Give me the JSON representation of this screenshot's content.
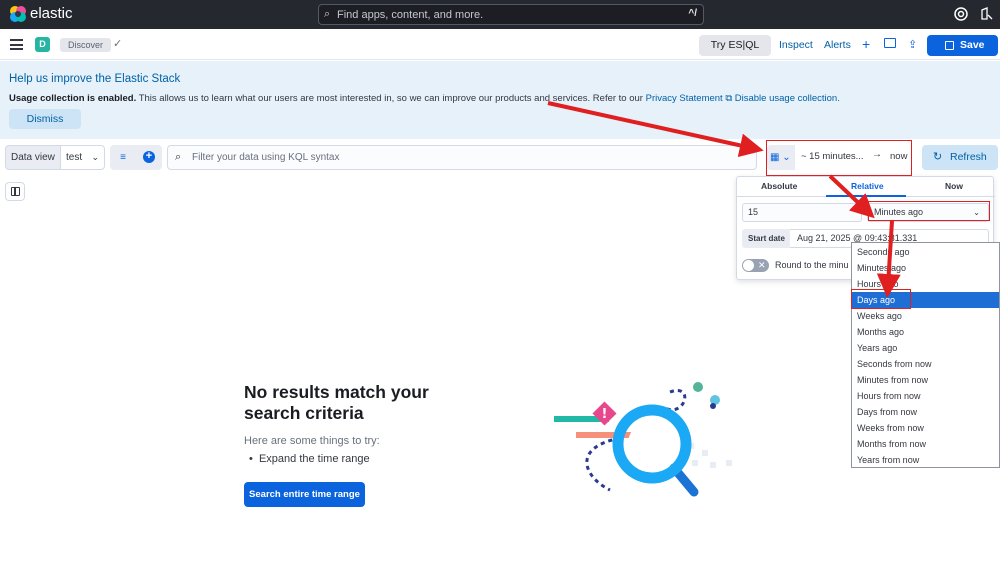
{
  "topbar": {
    "brand": "elastic",
    "search_placeholder": "Find apps, content, and more.",
    "search_shortcut": "^/",
    "icons": [
      "elastic-logo-icon",
      "help-icon",
      "user-settings-icon"
    ]
  },
  "appbar": {
    "space_initial": "D",
    "breadcrumb": "Discover",
    "try_esql": "Try ES|QL",
    "inspect": "Inspect",
    "alerts": "Alerts",
    "save": "Save"
  },
  "callout": {
    "title": "Help us improve the Elastic Stack",
    "body_bold": "Usage collection is enabled.",
    "body_text": " This allows us to learn what our users are most interested in, so we can improve our products and services. Refer to our ",
    "privacy_link": "Privacy Statement",
    "disable_link": "Disable usage collection.",
    "dismiss": "Dismiss"
  },
  "querybar": {
    "data_view_label": "Data view",
    "data_view_value": "test",
    "kql_placeholder": "Filter your data using KQL syntax",
    "start": "~ 15 minutes...",
    "arrow": "→",
    "end": "now",
    "refresh": "Refresh"
  },
  "popover": {
    "tabs": [
      "Absolute",
      "Relative",
      "Now"
    ],
    "active_tab": "Relative",
    "relative_value": "15",
    "relative_unit": "Minutes ago",
    "start_date_label": "Start date",
    "start_date_value": "Aug 21, 2025 @ 09:43:31.331",
    "round_label": "Round to the minu"
  },
  "unit_options": [
    "Seconds ago",
    "Minutes ago",
    "Hours ago",
    "Days ago",
    "Weeks ago",
    "Months ago",
    "Years ago",
    "Seconds from now",
    "Minutes from now",
    "Hours from now",
    "Days from now",
    "Weeks from now",
    "Months from now",
    "Years from now"
  ],
  "highlighted_option": "Days ago",
  "empty_state": {
    "title": "No results match your search criteria",
    "hint": "Here are some things to try:",
    "item": "Expand the time range",
    "button": "Search entire time range"
  },
  "colors": {
    "primary": "#0b64dd",
    "header_dark": "#25282f",
    "callout_bg": "#e6f1fa",
    "annotation_red": "#e02020"
  }
}
